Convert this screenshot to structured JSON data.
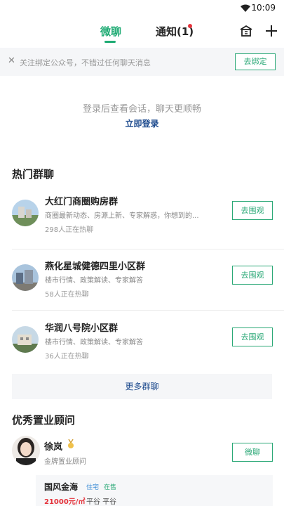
{
  "status_bar": {
    "time": "10:09"
  },
  "header": {
    "tabs": [
      {
        "label": "微聊"
      },
      {
        "label": "通知(1)"
      }
    ]
  },
  "bind_bar": {
    "message": "关注绑定公众号，不错过任何聊天消息",
    "button": "去绑定"
  },
  "login": {
    "tip": "登录后查看会话，聊天更顺畅",
    "link": "立即登录"
  },
  "hot_groups": {
    "title": "热门群聊",
    "items": [
      {
        "name": "大红门商圈购房群",
        "desc": "商圈最新动态、房源上新、专家解惑，你想到的...",
        "count": "298人正在热聊",
        "button": "去围观"
      },
      {
        "name": "燕化星城健德四里小区群",
        "desc": "楼市行情、政策解读、专家解答",
        "count": "58人正在热聊",
        "button": "去围观"
      },
      {
        "name": "华润八号院小区群",
        "desc": "楼市行情、政策解读、专家解答",
        "count": "36人正在热聊",
        "button": "去围观"
      }
    ],
    "more": "更多群聊"
  },
  "advisors": {
    "title": "优秀置业顾问",
    "items": [
      {
        "name": "徐岚",
        "title": "金牌置业顾问",
        "button": "微聊",
        "project": {
          "name": "国风金海",
          "tags": [
            "住宅",
            "在售"
          ],
          "price": "21000元/㎡",
          "area": "平谷 平谷"
        }
      }
    ]
  },
  "colors": {
    "accent": "#1fab74",
    "link": "#1e4b8e",
    "price": "#e5333b",
    "badge": "#e5333b"
  }
}
